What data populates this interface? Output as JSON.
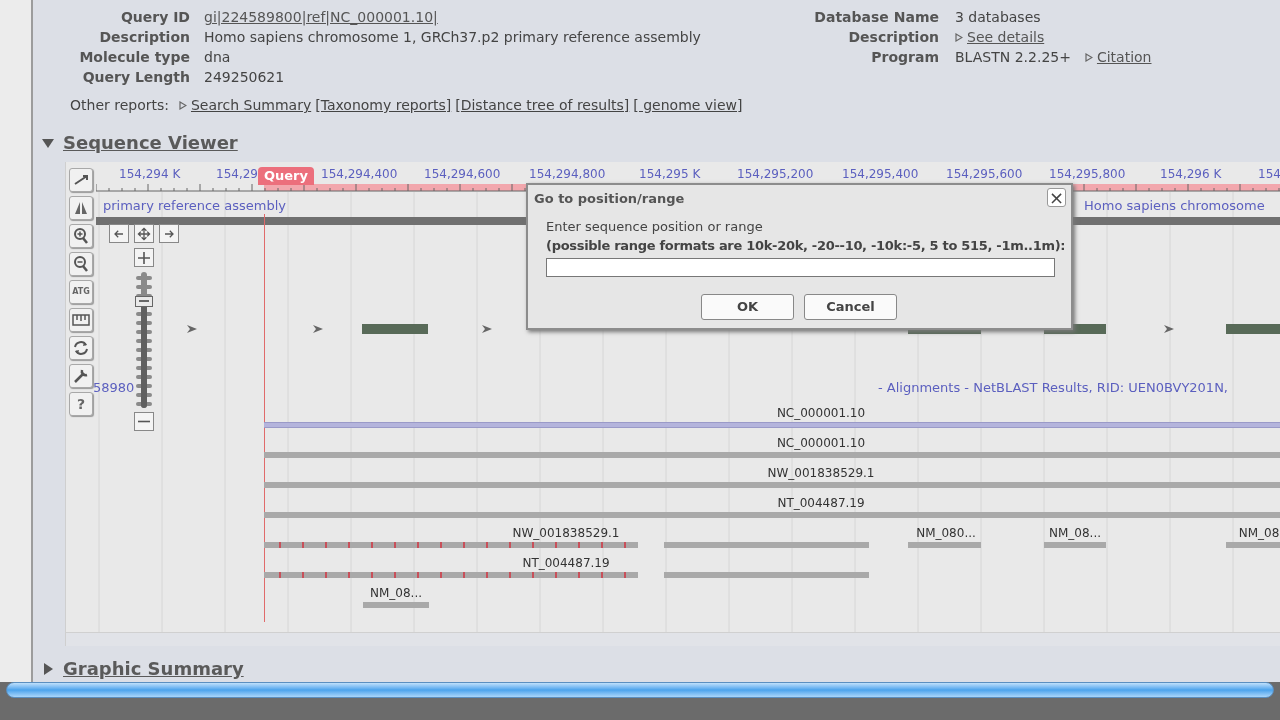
{
  "query_info": [
    {
      "label": "Query ID",
      "link": "gi|224589800|ref|NC_000001.10|"
    },
    {
      "label": "Description",
      "text": "Homo sapiens chromosome 1, GRCh37.p2 primary reference assembly"
    },
    {
      "label": "Molecule type",
      "text": "dna"
    },
    {
      "label": "Query Length",
      "text": "249250621"
    }
  ],
  "database_info": [
    {
      "label": "Database Name",
      "text": "3 databases"
    },
    {
      "label": "Description",
      "link": "See details"
    },
    {
      "label": "Program",
      "text": "BLASTN 2.2.25+",
      "link": "Citation"
    }
  ],
  "other_reports": {
    "label": "Other reports:",
    "links": [
      {
        "text": "Search Summary",
        "marker": true
      },
      {
        "text": "[Taxonomy reports]",
        "marker": false
      },
      {
        "text": "[Distance tree of results]",
        "marker": false
      },
      {
        "text": "[ genome view]",
        "marker": false
      }
    ]
  },
  "sequence_viewer": {
    "title": "Sequence Viewer",
    "expanded": true,
    "tools": [
      {
        "kind": "icon"
      },
      {
        "kind": "icon"
      },
      {
        "kind": "icon"
      },
      {
        "kind": "icon"
      },
      {
        "kind": "text",
        "label": "ATG"
      },
      {
        "kind": "icon"
      },
      {
        "kind": "icon"
      },
      {
        "kind": "icon"
      },
      {
        "kind": "text",
        "label": "?"
      }
    ],
    "zoom": {
      "level": 0.79
    },
    "ruler": [
      "154,294 K",
      "154,29",
      "154,294,400",
      "154,294,600",
      "154,294,800",
      "154,295 K",
      "154,295,200",
      "154,295,400",
      "154,295,600",
      "154,295,800",
      "154,296 K",
      "154"
    ],
    "query_marker": "Query",
    "sequence_labels": [
      "primary reference assembly",
      "Homo sapiens chromosome"
    ],
    "track_labels": [
      "58980",
      "-  Alignments - NetBLAST Results, RID: UEN0BVY201N,"
    ],
    "alignments": [
      {
        "label": "NC_000001.10",
        "kind": "query"
      },
      {
        "label": "NC_000001.10",
        "kind": "hit"
      },
      {
        "label": "NW_001838529.1",
        "kind": "hit"
      },
      {
        "label": "NT_004487.19",
        "kind": "hit"
      },
      {
        "label": "NW_001838529.1",
        "kind": "hit"
      },
      {
        "label": "NM_080...",
        "kind": "hit"
      },
      {
        "label": "NM_08...",
        "kind": "hit"
      },
      {
        "label": "NM_08",
        "kind": "hit"
      },
      {
        "label": "NT_004487.19",
        "kind": "hit"
      },
      {
        "label": "NM_08...",
        "kind": "hit"
      }
    ]
  },
  "dialog": {
    "title": "Go to position/range",
    "close": "×",
    "prompt": "Enter sequence position or range",
    "hint": "(possible range formats are 10k-20k, -20--10, -10k:-5, 5 to 515, -1m..1m):",
    "buttons": [
      "OK",
      "Cancel"
    ]
  },
  "graphic_summary": {
    "title": "Graphic Summary",
    "expanded": false
  }
}
